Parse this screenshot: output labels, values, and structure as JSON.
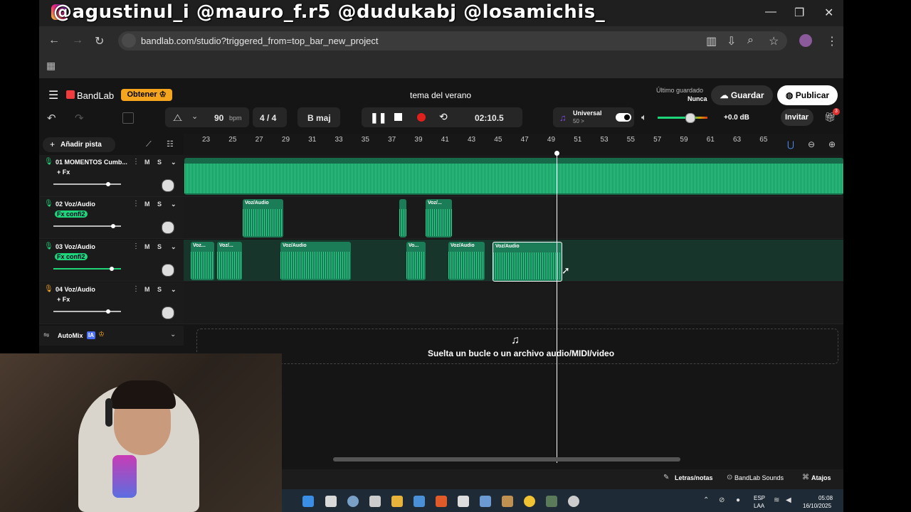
{
  "overlay": {
    "handles": "@agustinul_i  @mauro_f.r5  @dudukabj @losamichis_"
  },
  "browser": {
    "url": "bandlab.com/studio?triggered_from=top_bar_new_project",
    "window_controls": [
      "—",
      "❐",
      "✕"
    ]
  },
  "app": {
    "logo": "BandLab",
    "get_button": "Obtener",
    "project_title": "tema del verano",
    "last_saved_label": "Último guardado",
    "last_saved_value": "Nunca",
    "save_button": "Guardar",
    "publish_button": "Publicar",
    "invite_button": "Invitar",
    "notif_count": "3"
  },
  "transport": {
    "tempo": "90",
    "tempo_unit": "bpm",
    "time_signature": "4 / 4",
    "key": "B maj",
    "time": "02:10.5",
    "preset_name": "Universal",
    "preset_sub": "50 >",
    "master_db": "+0.0 dB"
  },
  "toolbar": {
    "add_track": "Añadir pista"
  },
  "ruler": {
    "ticks": [
      "23",
      "25",
      "27",
      "29",
      "31",
      "33",
      "35",
      "37",
      "39",
      "41",
      "43",
      "45",
      "47",
      "49",
      "51",
      "53",
      "55",
      "57",
      "59",
      "61",
      "63",
      "65"
    ]
  },
  "tracks": [
    {
      "name": "01  MOMENTOS Cumb...",
      "fx": "+ Fx",
      "fx_on": false,
      "volume": 0.78
    },
    {
      "name": "02  Voz/Audio",
      "fx": "Fx confi2",
      "fx_on": true,
      "volume": 0.85
    },
    {
      "name": "03  Voz/Audio",
      "fx": "Fx confi2",
      "fx_on": true,
      "volume": 0.83
    },
    {
      "name": "04  Voz/Audio",
      "fx": "+ Fx",
      "fx_on": false,
      "volume": 0.78
    }
  ],
  "clips": {
    "c2a": "Voz/Audio",
    "c2b": "Voz/...",
    "c3a": "Voz...",
    "c3b": "Voz/...",
    "c3c": "Voz/Audio",
    "c3d": "Vo...",
    "c3e": "Voz/Audio",
    "c3f": "Voz/Audio"
  },
  "track_btns": {
    "mute": "M",
    "solo": "S"
  },
  "automix": {
    "label": "AutoMix",
    "badge": "IA"
  },
  "dropzone": {
    "text": "Suelta un bucle o un archivo audio/MIDI/video"
  },
  "bottom": {
    "lyrics": "Letras/notas",
    "sounds": "BandLab Sounds",
    "shortcuts": "Atajos"
  },
  "taskbar": {
    "lang": "ESP",
    "region": "LAA",
    "clock": "05:08",
    "date": "16/10/2025"
  },
  "colors": {
    "accent": "#1fd57a",
    "brand": "#f03c3c",
    "gold": "#f5a51d"
  }
}
